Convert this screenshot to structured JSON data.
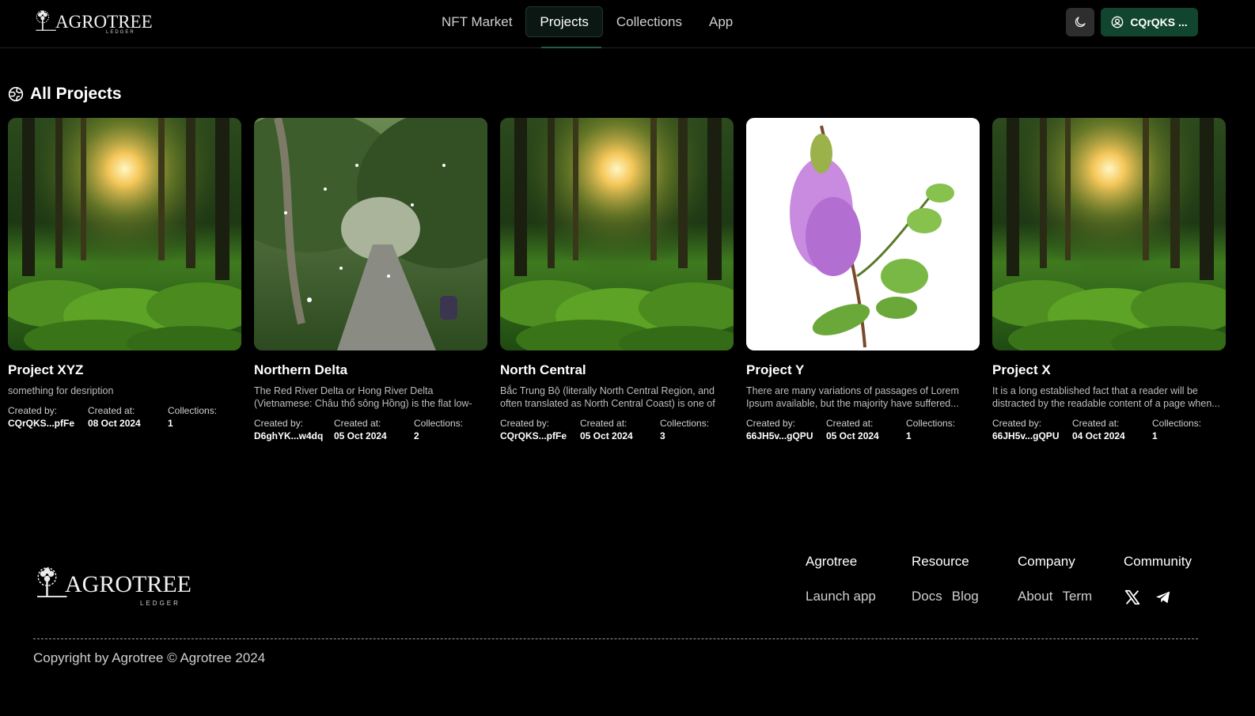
{
  "brand": {
    "name": "AGROTREE",
    "sub": "LEDGER"
  },
  "nav": {
    "items": [
      {
        "label": "NFT Market",
        "active": false
      },
      {
        "label": "Projects",
        "active": true
      },
      {
        "label": "Collections",
        "active": false
      },
      {
        "label": "App",
        "active": false
      }
    ]
  },
  "header": {
    "theme_icon": "moon-icon",
    "wallet_label": "CQrQKS ...",
    "wallet_icon": "user-circle-icon"
  },
  "section": {
    "title": "All Projects",
    "icon": "globe-icon"
  },
  "meta_labels": {
    "created_by": "Created by:",
    "created_at": "Created at:",
    "collections": "Collections:"
  },
  "projects": [
    {
      "title": "Project XYZ",
      "description": "something for desription",
      "image": "forest-sunlight",
      "created_by": "CQrQKS...pfFe",
      "created_at": "08 Oct 2024",
      "collections": "1"
    },
    {
      "title": "Northern Delta",
      "description": "The Red River Delta or Hong River Delta (Vietnamese: Châu thổ sông Hồng) is the flat low-lying plain...",
      "image": "forest-path",
      "created_by": "D6ghYK...w4dq",
      "created_at": "05 Oct 2024",
      "collections": "2"
    },
    {
      "title": "North Central",
      "description": "Bắc Trung Bộ (literally North Central Region, and often translated as North Central Coast) is one of th...",
      "image": "forest-sunlight",
      "created_by": "CQrQKS...pfFe",
      "created_at": "05 Oct 2024",
      "collections": "3"
    },
    {
      "title": "Project Y",
      "description": "There are many variations of passages of Lorem Ipsum available, but the majority have suffered...",
      "image": "lilac-flower",
      "created_by": "66JH5v...gQPU",
      "created_at": "05 Oct 2024",
      "collections": "1"
    },
    {
      "title": "Project X",
      "description": "It is a long established fact that a reader will be distracted by the readable content of a page when...",
      "image": "forest-sunlight",
      "created_by": "66JH5v...gQPU",
      "created_at": "04 Oct 2024",
      "collections": "1"
    }
  ],
  "footer": {
    "columns": [
      {
        "heading": "Agrotree",
        "links": [
          "Launch app"
        ]
      },
      {
        "heading": "Resource",
        "links": [
          "Docs",
          "Blog"
        ]
      },
      {
        "heading": "Company",
        "links": [
          "About",
          "Term"
        ]
      },
      {
        "heading": "Community",
        "icons": [
          "x-twitter-icon",
          "telegram-icon"
        ]
      }
    ],
    "copyright": "Copyright by Agrotree © Agrotree 2024"
  },
  "colors": {
    "background": "#000000",
    "accent": "#12452f",
    "active_tab": "#0b1713"
  }
}
